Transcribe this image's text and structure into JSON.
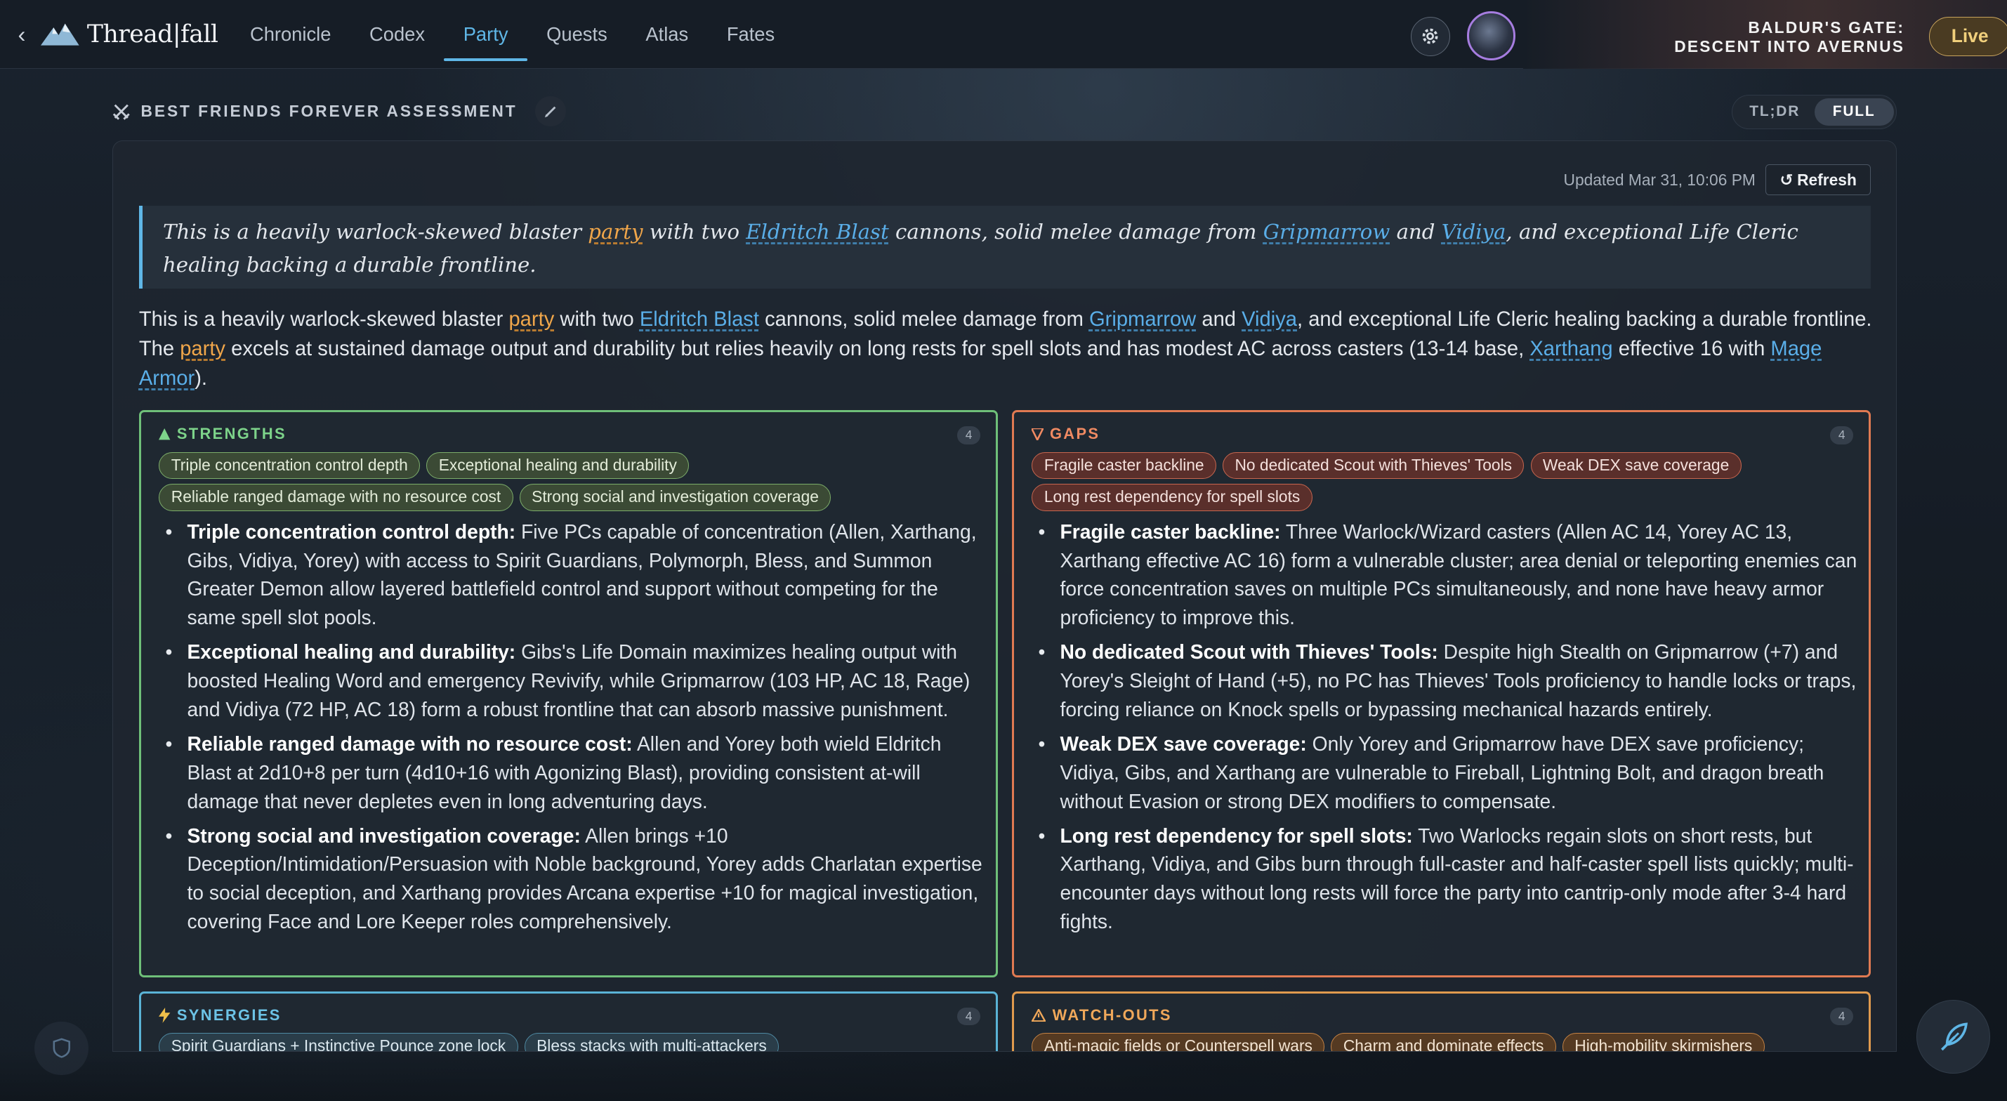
{
  "app": {
    "name": "Thread|fall",
    "back_icon": "chevron-left-icon",
    "logo_icon": "mountain-logo-icon"
  },
  "nav": {
    "tabs": [
      "Chronicle",
      "Codex",
      "Party",
      "Quests",
      "Atlas",
      "Fates"
    ],
    "active": "Party"
  },
  "header": {
    "settings_icon": "gear-icon",
    "campaign_line1": "BALDUR'S GATE:",
    "campaign_line2": "DESCENT INTO AVERNUS",
    "live_label": "Live"
  },
  "section": {
    "icon": "crossed-swords-icon",
    "title": "BEST FRIENDS FOREVER ASSESSMENT",
    "edit_icon": "pencil-icon",
    "toggle": {
      "left": "TL;DR",
      "right": "FULL",
      "active": "FULL"
    }
  },
  "panel": {
    "updated": "Updated Mar 31, 10:06 PM",
    "refresh_label": "Refresh",
    "quote": {
      "t1": "This is a heavily warlock-skewed blaster ",
      "l1": "party",
      "t2": " with two ",
      "l2": "Eldritch Blast",
      "t3": " cannons, solid melee damage from ",
      "l3": "Gripmarrow",
      "t4": " and ",
      "l4": "Vidiya",
      "t5": ", and exceptional Life Cleric healing backing a durable frontline."
    },
    "summary": {
      "t1": "This is a heavily warlock-skewed blaster ",
      "l1": "party",
      "t2": " with two ",
      "l2": "Eldritch Blast",
      "t3": " cannons, solid melee damage from ",
      "l3": "Gripmarrow",
      "t4": " and ",
      "l4": "Vidiya",
      "t5": ", and exceptional Life Cleric healing backing a durable frontline. The ",
      "l5": "party",
      "t6": " excels at sustained damage output and durability but relies heavily on long rests for spell slots and has modest AC across casters (13-14 base, ",
      "l6": "Xarthang",
      "t7": " effective 16 with ",
      "l7": "Mage Armor",
      "t8": ")."
    }
  },
  "cards": {
    "strengths": {
      "title": "STRENGTHS",
      "icon": "triangle-up-icon",
      "count": "4",
      "chips": [
        "Triple concentration control depth",
        "Exceptional healing and durability",
        "Reliable ranged damage with no resource cost",
        "Strong social and investigation coverage"
      ],
      "items": [
        {
          "label": "Triple concentration control depth:",
          "text": " Five PCs capable of concentration (Allen, Xarthang, Gibs, Vidiya, Yorey) with access to Spirit Guardians, Polymorph, Bless, and Summon Greater Demon allow layered battlefield control and support without competing for the same spell slot pools."
        },
        {
          "label": "Exceptional healing and durability:",
          "text": " Gibs's Life Domain maximizes healing output with boosted Healing Word and emergency Revivify, while Gripmarrow (103 HP, AC 18, Rage) and Vidiya (72 HP, AC 18) form a robust frontline that can absorb massive punishment."
        },
        {
          "label": "Reliable ranged damage with no resource cost:",
          "text": " Allen and Yorey both wield Eldritch Blast at 2d10+8 per turn (4d10+16 with Agonizing Blast), providing consistent at-will damage that never depletes even in long adventuring days."
        },
        {
          "label": "Strong social and investigation coverage:",
          "text": " Allen brings +10 Deception/Intimidation/Persuasion with Noble background, Yorey adds Charlatan expertise to social deception, and Xarthang provides Arcana expertise +10 for magical investigation, covering Face and Lore Keeper roles comprehensively."
        }
      ]
    },
    "gaps": {
      "title": "GAPS",
      "icon": "triangle-down-icon",
      "count": "4",
      "chips": [
        "Fragile caster backline",
        "No dedicated Scout with Thieves' Tools",
        "Weak DEX save coverage",
        "Long rest dependency for spell slots"
      ],
      "items": [
        {
          "label": "Fragile caster backline:",
          "text": " Three Warlock/Wizard casters (Allen AC 14, Yorey AC 13, Xarthang effective AC 16) form a vulnerable cluster; area denial or teleporting enemies can force concentration saves on multiple PCs simultaneously, and none have heavy armor proficiency to improve this."
        },
        {
          "label": "No dedicated Scout with Thieves' Tools:",
          "text": " Despite high Stealth on Gripmarrow (+7) and Yorey's Sleight of Hand (+5), no PC has Thieves' Tools proficiency to handle locks or traps, forcing reliance on Knock spells or bypassing mechanical hazards entirely."
        },
        {
          "label": "Weak DEX save coverage:",
          "text": " Only Yorey and Gripmarrow have DEX save proficiency; Vidiya, Gibs, and Xarthang are vulnerable to Fireball, Lightning Bolt, and dragon breath without Evasion or strong DEX modifiers to compensate."
        },
        {
          "label": "Long rest dependency for spell slots:",
          "text": " Two Warlocks regain slots on short rests, but Xarthang, Vidiya, and Gibs burn through full-caster and half-caster spell lists quickly; multi-encounter days without long rests will force the party into cantrip-only mode after 3-4 hard fights."
        }
      ]
    },
    "synergies": {
      "title": "SYNERGIES",
      "icon": "lightning-icon",
      "count": "4",
      "chips": [
        "Spirit Guardians + Instinctive Pounce zone lock",
        "Bless stacks with multi-attackers"
      ]
    },
    "watchouts": {
      "title": "WATCH-OUTS",
      "icon": "warning-icon",
      "count": "4",
      "chips": [
        "Anti-magic fields or Counterspell wars",
        "Charm and dominate effects",
        "High-mobility skirmishers"
      ]
    }
  },
  "footer": {
    "shield_icon": "shield-icon",
    "quill_icon": "quill-icon"
  },
  "colors": {
    "accent": "#5fb6e6",
    "strengths": "#6fc079",
    "gaps": "#e07a52",
    "synergies": "#5ab3d6",
    "watchouts": "#e09a4e",
    "live": "#c8a45c"
  }
}
